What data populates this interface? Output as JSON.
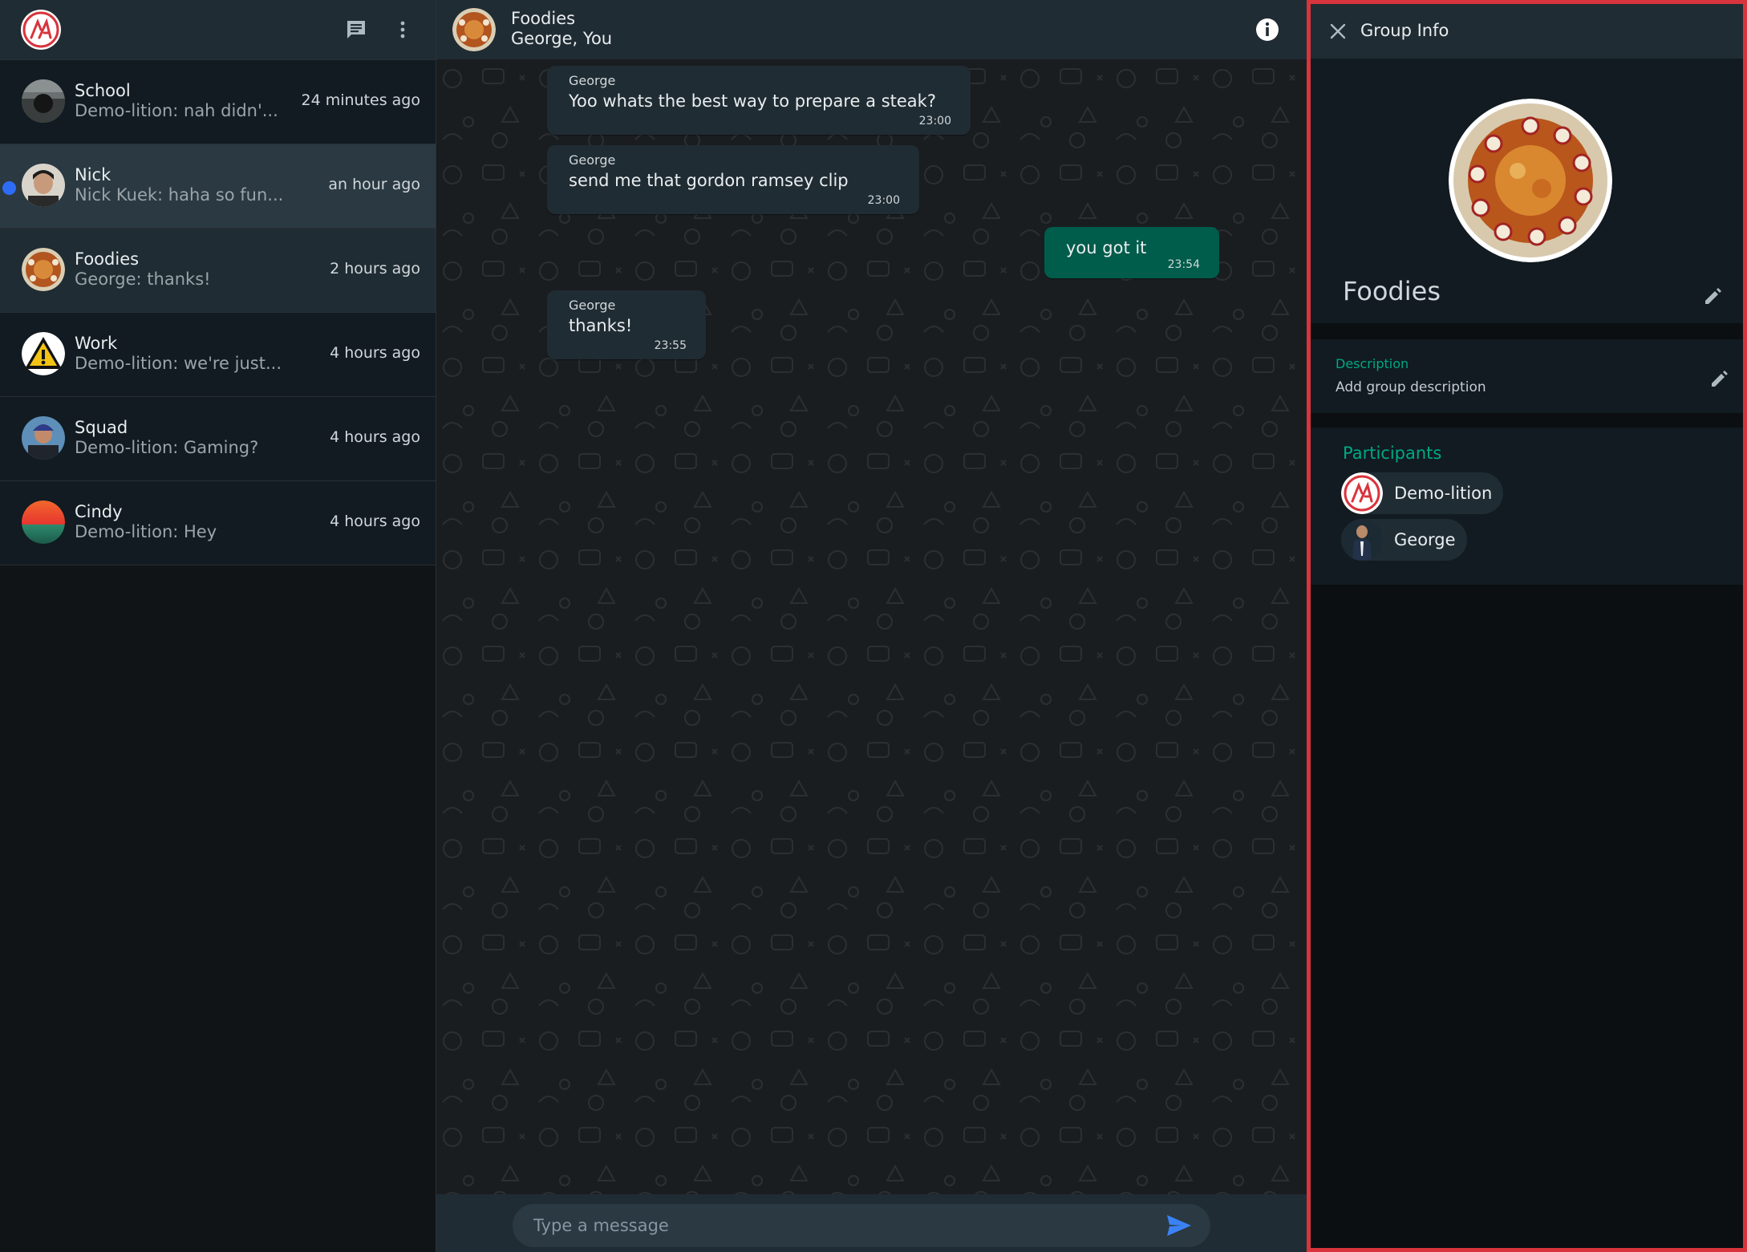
{
  "sidebar": {
    "chats": [
      {
        "name": "School",
        "preview": "Demo-lition: nah didn'...",
        "time": "24 minutes ago"
      },
      {
        "name": "Nick",
        "preview": "Nick Kuek: haha so fun...",
        "time": "an hour ago",
        "unread": true
      },
      {
        "name": "Foodies",
        "preview": "George: thanks!",
        "time": "2 hours ago"
      },
      {
        "name": "Work",
        "preview": "Demo-lition: we're just...",
        "time": "4 hours ago"
      },
      {
        "name": "Squad",
        "preview": "Demo-lition: Gaming?",
        "time": "4 hours ago"
      },
      {
        "name": "Cindy",
        "preview": "Demo-lition: Hey",
        "time": "4 hours ago"
      }
    ]
  },
  "conversation": {
    "title": "Foodies",
    "subtitle": "George, You",
    "messages": [
      {
        "sender": "George",
        "text": "Yoo whats the best way to prepare a steak?",
        "time": "23:00",
        "outgoing": false
      },
      {
        "sender": "George",
        "text": "send me that gordon ramsey clip",
        "time": "23:00",
        "outgoing": false
      },
      {
        "sender": "",
        "text": "you got it",
        "time": "23:54",
        "outgoing": true
      },
      {
        "sender": "George",
        "text": "thanks!",
        "time": "23:55",
        "outgoing": false
      }
    ],
    "composer_placeholder": "Type a message"
  },
  "group_info": {
    "header_title": "Group Info",
    "group_name": "Foodies",
    "description_label": "Description",
    "description_placeholder": "Add group description",
    "participants_label": "Participants",
    "participants": [
      "Demo-lition",
      "George"
    ]
  },
  "colors": {
    "accent": "#00a884",
    "outgoing_bubble": "#005c4b",
    "incoming_bubble": "#202c33",
    "highlight_border": "#d8343d",
    "unread_dot": "#2e6cf6"
  }
}
